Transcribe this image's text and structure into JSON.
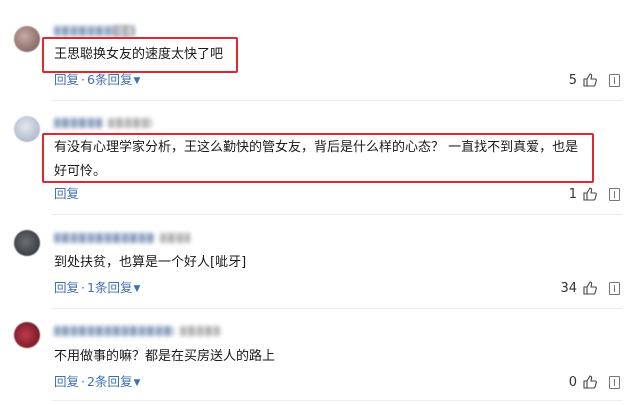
{
  "comments": [
    {
      "text": "王思聪换女友的速度太快了吧",
      "reply_label": "回复",
      "sub_replies_label": "6条回复",
      "like_count": "5"
    },
    {
      "text": "有没有心理学家分析，王这么勤快的管女友，背后是什么样的心态？ 一直找不到真爱，也是好可怜。",
      "reply_label": "回复",
      "sub_replies_label": "",
      "like_count": "1"
    },
    {
      "text": "到处扶贫，也算是一个好人[呲牙]",
      "reply_label": "回复",
      "sub_replies_label": "1条回复",
      "like_count": "34"
    },
    {
      "text": "不用做事的嘛？都是在买房送人的路上",
      "reply_label": "回复",
      "sub_replies_label": "2条回复",
      "like_count": "0"
    }
  ],
  "colors": {
    "link": "#3d6fb5",
    "highlight_box": "#e0282e",
    "divider": "#ececec"
  },
  "icons": {
    "like": "thumbs-up-icon",
    "report": "report-icon",
    "expand": "chevron-down-icon"
  }
}
